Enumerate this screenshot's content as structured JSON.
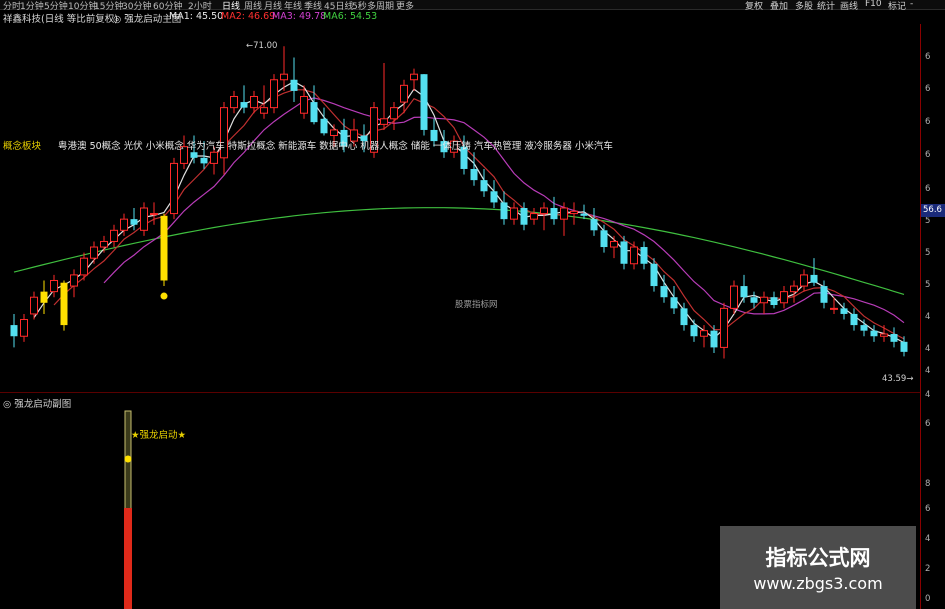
{
  "top_bar": {
    "periods": [
      "分时",
      "1分钟",
      "5分钟",
      "10分钟",
      "15分钟",
      "30分钟",
      "60分钟",
      "2小时",
      "日线",
      "周线",
      "月线",
      "年线",
      "季线",
      "45日线",
      "5秒",
      "多周期",
      "更多"
    ],
    "active_period": "日线",
    "tools": [
      "复权",
      "叠加",
      "多股",
      "统计",
      "画线",
      "F10",
      "标记",
      "-"
    ]
  },
  "title_bar": {
    "stock": "祥鑫科技(日线 等比前复权)",
    "indicator": "◎ 强龙启动主图",
    "ma1": "MA1: 45.50",
    "ma2": "MA2: 46.69",
    "ma3": "MA3: 49.78",
    "ma6": "MA6: 54.53",
    "colors": {
      "ma1": "#e8e8e8",
      "ma2": "#ff3030",
      "ma3": "#d040d0",
      "ma6": "#40d040"
    }
  },
  "concept": {
    "label": "概念板块",
    "text": "粤港澳 50概念 光伏 小米概念 华为汽车 特斯拉概念 新能源车 数据中心 机器人概念 储能 一体压铸 汽车热管理 液冷服务器 小米汽车"
  },
  "price_annotations": {
    "high": "71.00",
    "low": "43.59"
  },
  "center_watermark": "股票指标网",
  "right_axis": {
    "badge": "56.6",
    "labels": [
      "6",
      "6",
      "6",
      "6",
      "6",
      "5",
      "5",
      "5",
      "4",
      "4",
      "4",
      "4",
      "6",
      "8",
      "6",
      "4",
      "2",
      "0"
    ]
  },
  "sub_chart": {
    "title": "◎ 强龙启动副图",
    "signal_label": "★强龙启动★"
  },
  "watermark": {
    "line1": "指标公式网",
    "line2": "www.zbgs3.com"
  },
  "chart_data": {
    "type": "candlestick",
    "ohlc": [
      [
        46,
        47,
        44,
        45
      ],
      [
        45,
        47,
        44.5,
        46.5
      ],
      [
        47,
        49,
        46.5,
        48.5
      ],
      [
        48,
        50,
        47,
        49
      ],
      [
        49,
        50.5,
        48.5,
        50
      ],
      [
        46,
        50,
        45.5,
        49.8
      ],
      [
        49.5,
        51,
        48.5,
        50.5
      ],
      [
        50.5,
        52.5,
        50,
        52
      ],
      [
        52,
        53.5,
        51.5,
        53
      ],
      [
        53,
        54,
        52.5,
        53.5
      ],
      [
        53.5,
        55,
        53,
        54.5
      ],
      [
        54.5,
        56,
        54,
        55.5
      ],
      [
        55.5,
        56.5,
        54.5,
        55
      ],
      [
        54.5,
        57,
        54,
        56.5
      ],
      [
        56,
        57,
        55,
        56
      ],
      [
        50,
        56,
        49.5,
        55.8
      ],
      [
        56,
        61,
        55.5,
        60.5
      ],
      [
        60.5,
        63,
        60,
        62
      ],
      [
        61.5,
        63,
        60.5,
        61
      ],
      [
        61,
        62.5,
        60,
        60.5
      ],
      [
        60.5,
        62,
        59.5,
        61.5
      ],
      [
        61,
        66,
        59.5,
        65.5
      ],
      [
        65.5,
        67,
        65,
        66.5
      ],
      [
        66,
        67.5,
        65,
        65.5
      ],
      [
        65.5,
        67,
        65,
        66.5
      ],
      [
        65,
        67.5,
        64.5,
        65.5
      ],
      [
        65.5,
        68.5,
        65,
        68
      ],
      [
        68,
        71,
        67,
        68.5
      ],
      [
        68,
        70,
        66,
        67
      ],
      [
        65,
        67.5,
        64.5,
        66.5
      ],
      [
        66,
        67.5,
        64,
        64.2
      ],
      [
        64.5,
        65.5,
        63,
        63.2
      ],
      [
        63,
        64,
        62,
        63.5
      ],
      [
        63.5,
        64.5,
        61.5,
        62
      ],
      [
        62.5,
        64.5,
        62,
        63.5
      ],
      [
        63,
        64,
        61.5,
        62.5
      ],
      [
        61.5,
        66,
        61,
        65.5
      ],
      [
        64,
        69.5,
        63.5,
        64.5
      ],
      [
        64.5,
        66,
        63.5,
        65.5
      ],
      [
        66,
        68,
        65,
        67.5
      ],
      [
        68,
        69,
        67,
        68.5
      ],
      [
        68.5,
        68.5,
        63,
        63.5
      ],
      [
        63.5,
        64.5,
        62,
        62.5
      ],
      [
        62.5,
        63.5,
        61,
        61.5
      ],
      [
        61.5,
        63,
        61,
        62.5
      ],
      [
        62,
        63,
        59.5,
        60
      ],
      [
        60,
        61.5,
        58.5,
        59
      ],
      [
        59,
        60,
        57.5,
        58
      ],
      [
        58,
        59,
        56.5,
        57
      ],
      [
        57,
        58,
        55,
        55.5
      ],
      [
        55.5,
        57,
        55,
        56.5
      ],
      [
        56.5,
        57,
        54.5,
        55
      ],
      [
        55.5,
        56.5,
        55,
        56
      ],
      [
        56,
        57,
        54.5,
        56.5
      ],
      [
        56.5,
        57.5,
        55,
        55.5
      ],
      [
        55.5,
        57,
        54,
        56.5
      ],
      [
        56,
        57,
        55,
        56.2
      ],
      [
        56,
        56.8,
        55.5,
        55.8
      ],
      [
        55.5,
        56.5,
        54,
        54.5
      ],
      [
        54.5,
        55,
        52.5,
        53
      ],
      [
        53,
        54,
        52,
        53.5
      ],
      [
        53.5,
        54,
        51,
        51.5
      ],
      [
        51.5,
        53.5,
        51,
        53
      ],
      [
        53,
        53.5,
        51,
        51.5
      ],
      [
        51.5,
        52,
        49,
        49.5
      ],
      [
        49.5,
        50.5,
        48,
        48.5
      ],
      [
        48.5,
        49.5,
        47,
        47.5
      ],
      [
        47.5,
        48,
        45.5,
        46
      ],
      [
        46,
        46.5,
        44.5,
        45
      ],
      [
        45,
        46,
        44,
        45.5
      ],
      [
        45.5,
        46,
        43.5,
        44
      ],
      [
        44,
        48,
        43,
        47.5
      ],
      [
        47.5,
        50,
        47,
        49.5
      ],
      [
        49.5,
        50.5,
        48,
        48.5
      ],
      [
        48.5,
        49,
        47.5,
        48
      ],
      [
        48,
        49,
        47,
        48.5
      ],
      [
        48.5,
        49,
        47.5,
        47.8
      ],
      [
        48,
        49.5,
        47.5,
        49
      ],
      [
        49,
        50,
        48,
        49.5
      ],
      [
        49.5,
        51,
        49,
        50.5
      ],
      [
        50.5,
        52,
        49.5,
        49.8
      ],
      [
        49.5,
        50,
        47.5,
        48
      ],
      [
        47.5,
        48.5,
        47,
        47.5
      ],
      [
        47.5,
        48,
        46.5,
        47
      ],
      [
        47,
        47.5,
        45.5,
        46
      ],
      [
        46,
        46.5,
        45,
        45.5
      ],
      [
        45.5,
        46,
        44.5,
        45
      ],
      [
        45,
        46,
        44.5,
        45.2
      ],
      [
        45.2,
        45.8,
        44,
        44.5
      ],
      [
        44.5,
        45,
        43.2,
        43.6
      ]
    ],
    "ylim": [
      40,
      73
    ],
    "grid": false
  }
}
